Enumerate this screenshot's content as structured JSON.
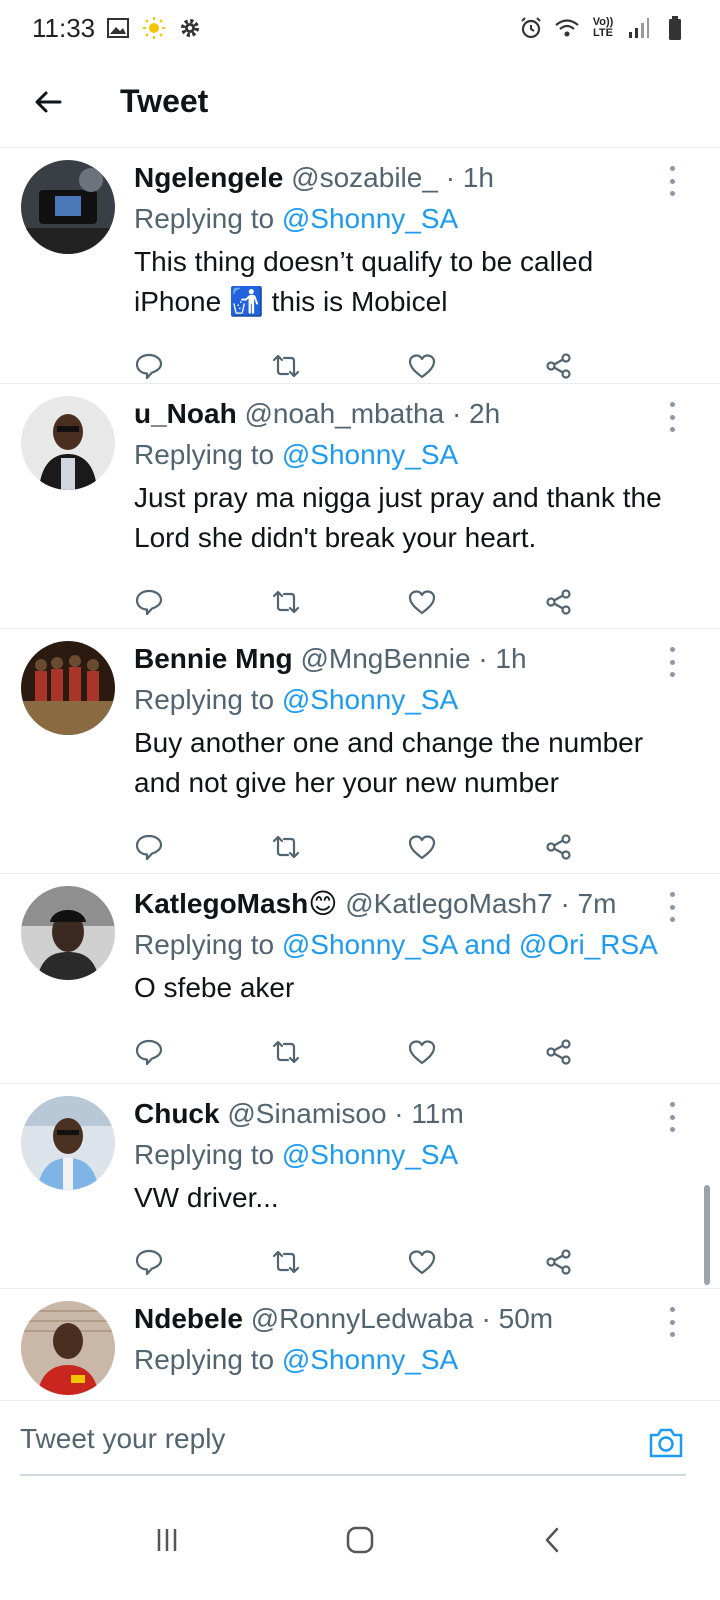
{
  "status_bar": {
    "time": "11:33",
    "icons_left": [
      "image-icon",
      "weather-sun-icon",
      "settings-gear-icon"
    ],
    "icons_right": [
      "alarm-icon",
      "wifi-icon",
      "volte-lte-icon",
      "signal-icon",
      "battery-icon"
    ],
    "network": "Vo)) LTE"
  },
  "header": {
    "title": "Tweet",
    "back_icon": "back-arrow-icon"
  },
  "tweets": [
    {
      "name": "Ngelengele",
      "handle": "@sozabile_",
      "time": "· 1h",
      "replying_prefix": "Replying to ",
      "replying_to": "@Shonny_SA",
      "text": "This thing doesn’t qualify to be called iPhone 🚮 this is Mobicel"
    },
    {
      "name": "u_Noah",
      "handle": "@noah_mbatha",
      "time": "· 2h",
      "replying_prefix": "Replying to ",
      "replying_to": "@Shonny_SA",
      "text": "Just pray ma nigga just pray and thank the Lord she didn't break your heart."
    },
    {
      "name": "Bennie Mng",
      "handle": "@MngBennie",
      "time": "· 1h",
      "replying_prefix": "Replying to ",
      "replying_to": "@Shonny_SA",
      "text": "Buy another one and change the number and not give her your new number"
    },
    {
      "name": "KatlegoMash😊",
      "handle": "@KatlegoMash7",
      "time": "· 7m",
      "replying_prefix": "Replying to ",
      "replying_to": "@Shonny_SA and @Ori_RSA",
      "text": "O sfebe aker"
    },
    {
      "name": "Chuck",
      "handle": "@Sinamisoo",
      "time": "· 11m",
      "replying_prefix": "Replying to ",
      "replying_to": "@Shonny_SA",
      "text": "VW driver..."
    },
    {
      "name": "Ndebele",
      "handle": "@RonnyLedwaba",
      "time": "· 50m",
      "replying_prefix": "Replying to ",
      "replying_to": "@Shonny_SA",
      "text": ""
    }
  ],
  "reply_bar": {
    "placeholder": "Tweet your reply",
    "camera_icon": "camera-icon"
  },
  "nav_bar": {
    "icons": [
      "recent-apps-icon",
      "home-icon",
      "back-icon"
    ]
  },
  "colors": {
    "accent": "#1d9bf0",
    "secondary_text": "#536471",
    "divider": "#e6ecf0"
  }
}
